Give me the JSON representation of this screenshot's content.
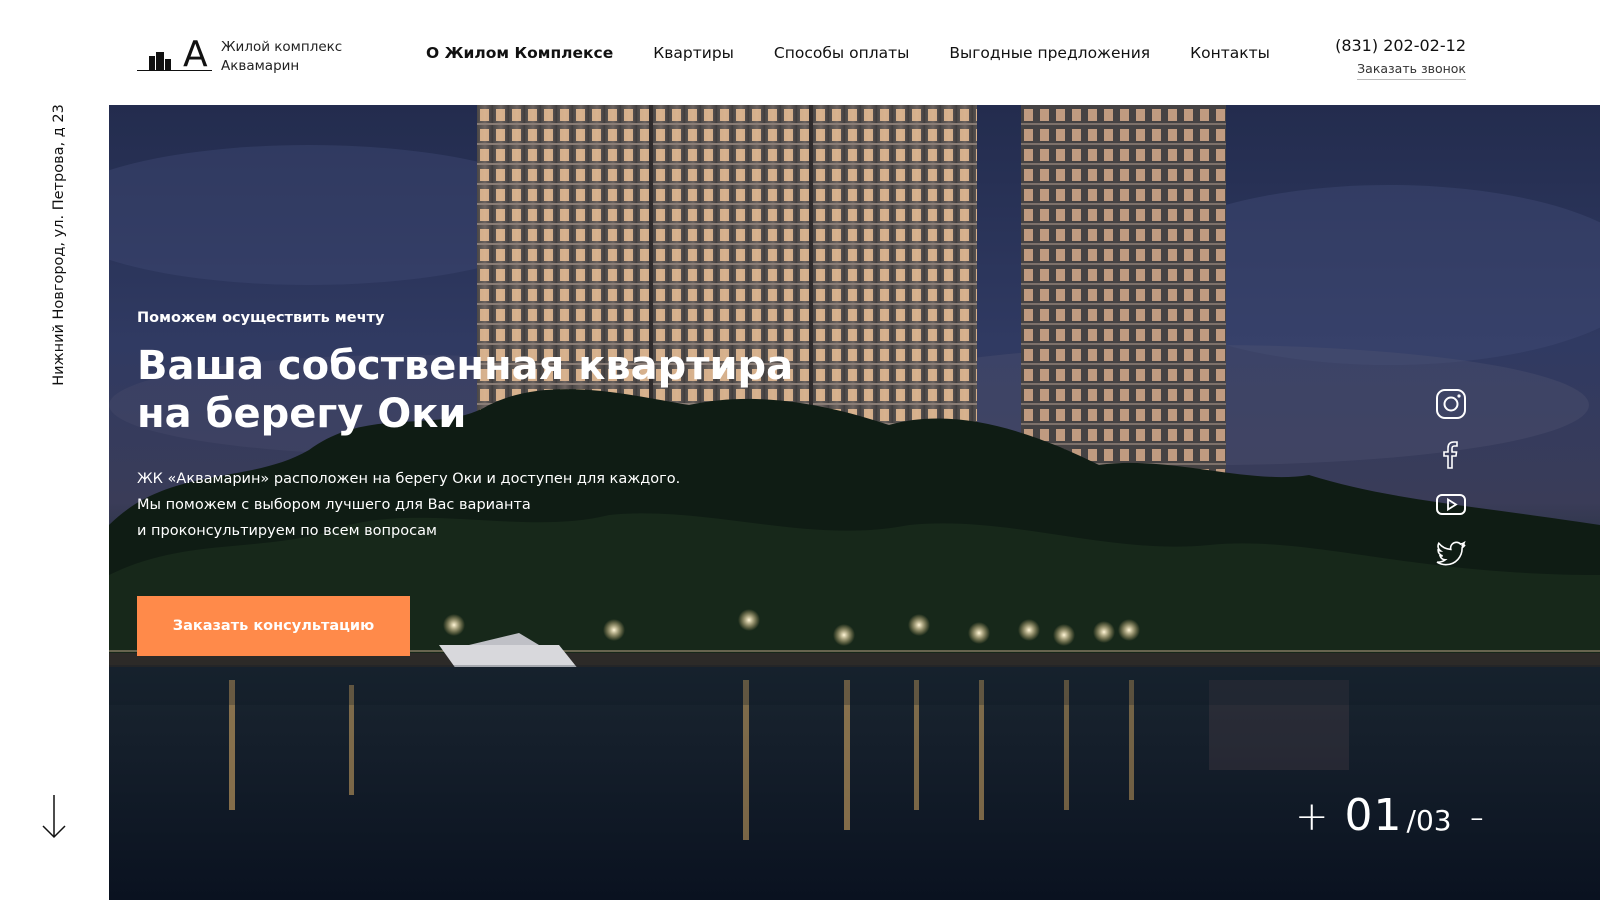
{
  "logo": {
    "letter": "A",
    "line1": "Жилой комплекс",
    "line2": "Аквамарин"
  },
  "nav": [
    {
      "label": "О Жилом Комплексе",
      "active": true
    },
    {
      "label": "Квартиры",
      "active": false
    },
    {
      "label": "Способы оплаты",
      "active": false
    },
    {
      "label": "Выгодные предложения",
      "active": false
    },
    {
      "label": "Контакты",
      "active": false
    }
  ],
  "contact": {
    "phone": "(831) 202-02-12",
    "callback_label": "Заказать звонок"
  },
  "address": "Нижний Новгород, ул. Петрова, д 23",
  "hero": {
    "eyebrow": "Поможем осуществить мечту",
    "headline_line1": "Ваша собственная квартира",
    "headline_line2": "на берегу Оки",
    "desc_line1": "ЖК «Аквамарин» расположен на берегу Оки и доступен для каждого.",
    "desc_line2": "Мы поможем с выбором лучшего для Вас варианта",
    "desc_line3": "и проконсультируем по всем вопросам",
    "cta_label": "Заказать консультацию",
    "cta_color": "#ff8a4a"
  },
  "socials": [
    {
      "name": "instagram-icon"
    },
    {
      "name": "facebook-icon"
    },
    {
      "name": "youtube-icon"
    },
    {
      "name": "twitter-icon"
    }
  ],
  "slider": {
    "prev_label": "+",
    "current": "01",
    "separator": "/",
    "total": "03",
    "next_label": "-"
  },
  "icons": {
    "scroll": "arrow-down-icon"
  }
}
